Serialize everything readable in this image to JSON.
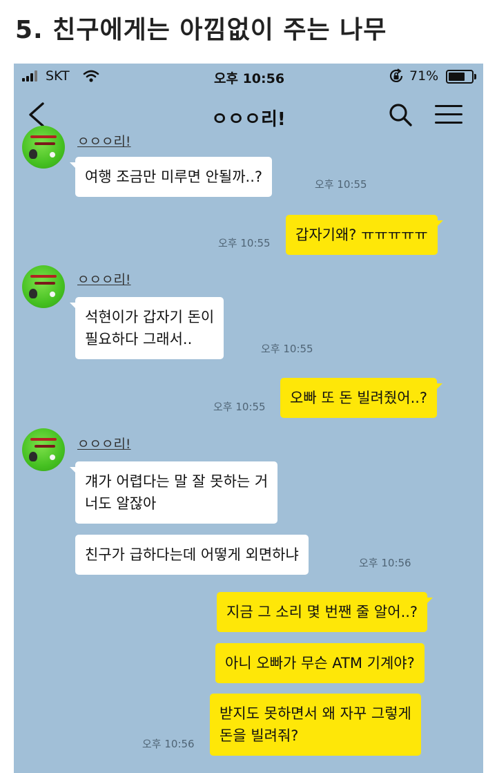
{
  "article_title": "5. 친구에게는 아낌없이 주는 나무",
  "status_bar": {
    "carrier": "SKT",
    "time": "오후 10:56",
    "battery_percent_label": "71%",
    "battery_level": 0.71,
    "icons": [
      "signal-icon",
      "wifi-icon",
      "rotation-lock-icon",
      "battery-icon"
    ]
  },
  "navbar": {
    "title": "ㅇㅇㅇ리!",
    "icons": [
      "back-arrow-icon",
      "search-icon",
      "menu-icon"
    ]
  },
  "chat": {
    "partial_sender": "ㅇㅇㅇ리!",
    "messages": [
      {
        "side": "in",
        "text": "여행 조금만 미루면 안될까..?",
        "time": "오후 10:55"
      },
      {
        "side": "out",
        "text": "갑자기왜? ㅠㅠㅠㅠㅠ",
        "time": "오후 10:55"
      },
      {
        "side": "in",
        "sender": "ㅇㅇㅇ리!",
        "lines": [
          "석현이가 갑자기 돈이",
          "필요하다 그래서.."
        ],
        "time": "오후 10:55"
      },
      {
        "side": "out",
        "text": "오빠 또 돈 빌려줬어..?",
        "time": "오후 10:55"
      },
      {
        "side": "in",
        "sender": "ㅇㅇㅇ리!",
        "lines": [
          "걔가 어렵다는 말 잘 못하는 거",
          "너도 알잖아"
        ]
      },
      {
        "side": "in",
        "text": "친구가 급하다는데 어떻게 외면하냐",
        "time": "오후 10:56"
      },
      {
        "side": "out",
        "text": "지금 그 소리 몇 번짼 줄 알어..?"
      },
      {
        "side": "out",
        "text": "아니 오빠가 무슨 ATM 기계야?"
      },
      {
        "side": "out",
        "lines": [
          "받지도 못하면서 왜 자꾸 그렇게",
          "돈을 빌려줘?"
        ],
        "time": "오후 10:56"
      }
    ]
  },
  "colors": {
    "chat_background": "#a1bfd7",
    "outgoing_bubble": "#fee708",
    "incoming_bubble": "#ffffff",
    "avatar_green": "#45c021"
  }
}
